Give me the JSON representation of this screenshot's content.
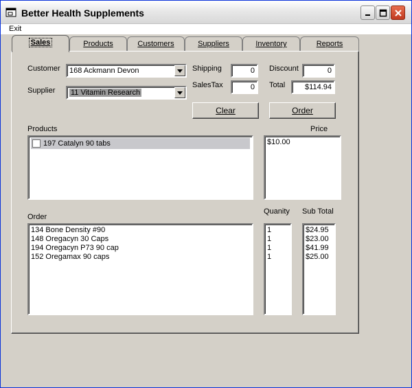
{
  "window": {
    "title": "Better Health Supplements"
  },
  "menu": {
    "exit_label": "Exit"
  },
  "tabs": [
    "Sales",
    "Products",
    "Customers",
    "Suppliers",
    "Inventory",
    "Reports"
  ],
  "sales": {
    "customer_label": "Customer",
    "customer_value": "168 Ackmann Devon",
    "supplier_label": "Supplier",
    "supplier_value": "11 Vitamin Research",
    "shipping_label": "Shipping",
    "shipping_value": "0",
    "salestax_label": "SalesTax",
    "salestax_value": "0",
    "discount_label": "Discount",
    "discount_value": "0",
    "total_label": "Total",
    "total_value": "$114.94",
    "clear_label": "Clear",
    "order_button_label": "Order",
    "products_label": "Products",
    "price_label": "Price",
    "products": [
      {
        "label": "197 Catalyn 90 tabs",
        "checked": false
      }
    ],
    "prices": [
      "$10.00"
    ],
    "order_label": "Order",
    "quantity_label": "Quanity",
    "subtotal_label": "Sub Total",
    "order_items": [
      "134 Bone Density #90",
      "148 Oregacyn 30 Caps",
      "194 Oregacyn P73 90 cap",
      "152 Oregamax 90 caps"
    ],
    "quantities": [
      "1",
      "1",
      "1",
      "1"
    ],
    "subtotals": [
      "$24.95",
      "$23.00",
      "$41.99",
      "$25.00"
    ]
  }
}
